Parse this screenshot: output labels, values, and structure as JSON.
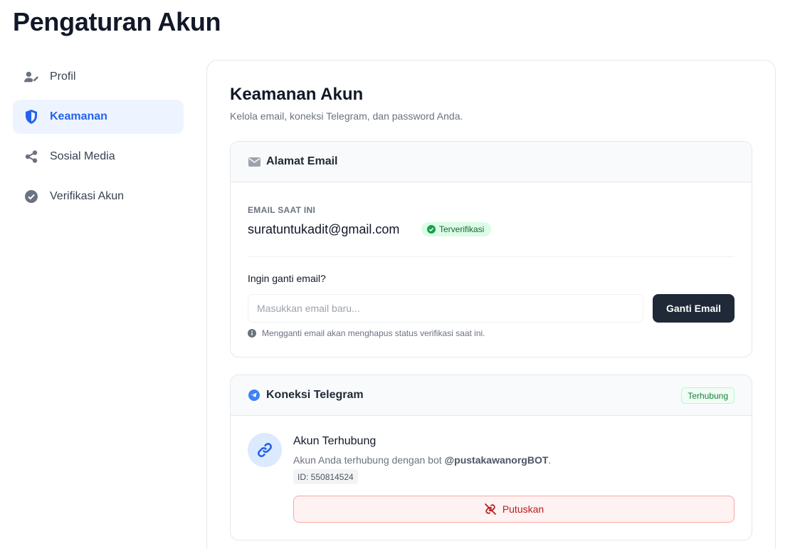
{
  "page": {
    "title": "Pengaturan Akun"
  },
  "sidebar": {
    "items": [
      {
        "label": "Profil",
        "icon": "user-edit-icon",
        "active": false
      },
      {
        "label": "Keamanan",
        "icon": "shield-icon",
        "active": true
      },
      {
        "label": "Sosial Media",
        "icon": "share-icon",
        "active": false
      },
      {
        "label": "Verifikasi Akun",
        "icon": "check-circle-icon",
        "active": false
      }
    ]
  },
  "security": {
    "title": "Keamanan Akun",
    "subtitle": "Kelola email, koneksi Telegram, dan password Anda."
  },
  "email_card": {
    "title": "Alamat Email",
    "current_label": "EMAIL SAAT INI",
    "current_email": "suratuntukadit@gmail.com",
    "verified_badge": "Terverifikasi",
    "change_label": "Ingin ganti email?",
    "input_placeholder": "Masukkan email baru...",
    "input_value": "",
    "button_label": "Ganti Email",
    "hint": "Mengganti email akan menghapus status verifikasi saat ini."
  },
  "telegram_card": {
    "title": "Koneksi Telegram",
    "status_badge": "Terhubung",
    "account_title": "Akun Terhubung",
    "desc_prefix": "Akun Anda terhubung dengan bot ",
    "bot_name": "@pustakawanorgBOT",
    "desc_suffix": ".",
    "id_label": "ID: 550814524",
    "disconnect_label": "Putuskan"
  },
  "colors": {
    "accent": "#2563eb",
    "active_bg": "#eef4ff",
    "dark_button": "#1f2937",
    "success": "#16a34a",
    "danger": "#b91c1c"
  }
}
